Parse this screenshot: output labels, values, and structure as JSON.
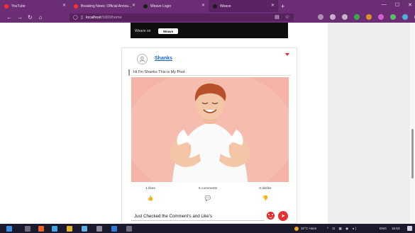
{
  "browser": {
    "tabs": [
      {
        "label": "YouTube",
        "icon": "youtube-icon",
        "color": "#ff2d2d",
        "active": false
      },
      {
        "label": "Breaking News: Official Annou...",
        "icon": "youtube-icon",
        "color": "#ff2d2d",
        "active": false
      },
      {
        "label": "Weave Login",
        "icon": "weave-icon",
        "color": "#1c1c1c",
        "active": false
      },
      {
        "label": "Weave",
        "icon": "weave-icon",
        "color": "#1c1c1c",
        "active": true
      }
    ],
    "new_tab": "+",
    "window_controls": {
      "minimize": "—",
      "maximize": "☐",
      "close": "✕"
    },
    "url_host": "localhost",
    "url_path": ":5000/home"
  },
  "feed": {
    "previous_post_label": "Weave on",
    "previous_post_badge": "Weave"
  },
  "post": {
    "username": "Shanks",
    "text": "Hi I'm Shanks This is My Post",
    "likes_label": "1 likes",
    "comments_label": "0 comments",
    "dislikes_label": "0 dislike",
    "comment_value": "Just Checked the Comment's and Like's"
  },
  "taskbar": {
    "weather": "32°C Haze",
    "language": "ENG",
    "time": "15:53"
  },
  "colors": {
    "browser_chrome": "#6b2d74",
    "link_blue": "#1b62c5",
    "accent_red": "#e43232",
    "photo_bg": "#f4b3a5"
  }
}
